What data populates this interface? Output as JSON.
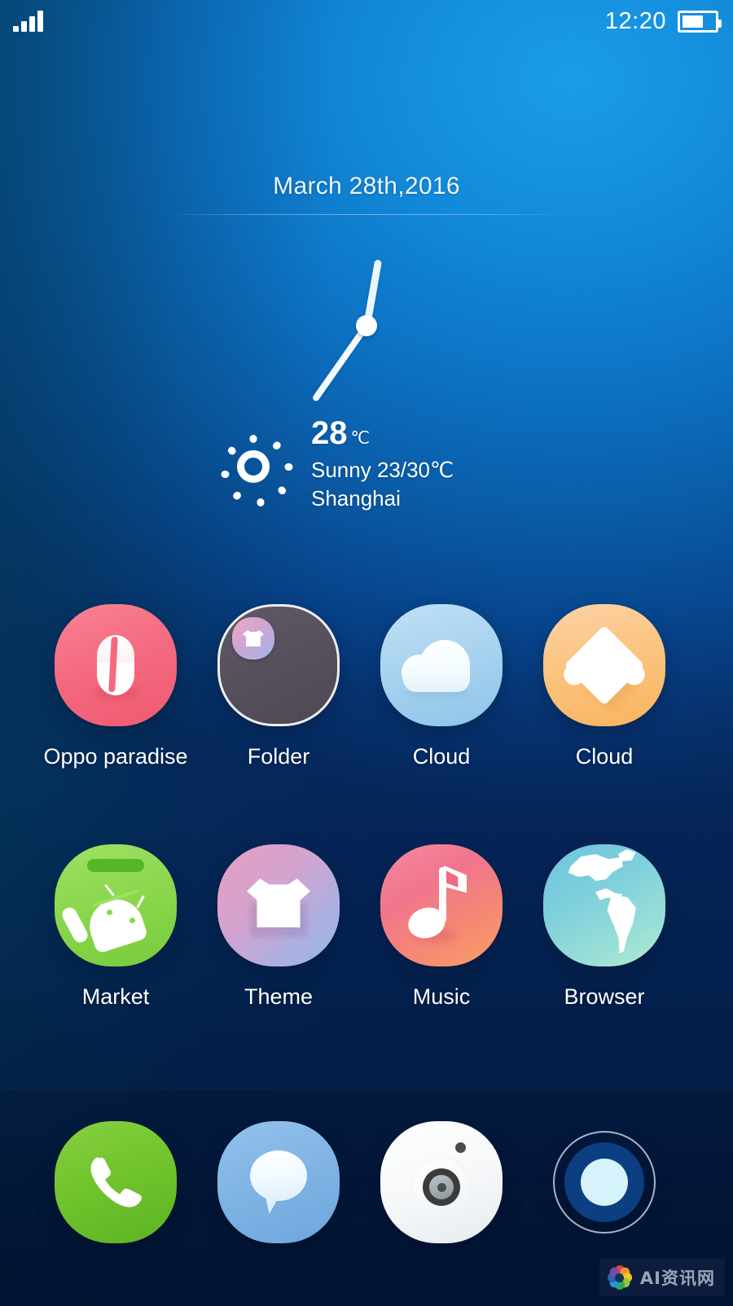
{
  "status_bar": {
    "signal_icon": "signal-bars-icon",
    "signal_bars": 4,
    "time": "12:20",
    "battery_icon": "battery-icon",
    "battery_percent": 65
  },
  "widgets": {
    "date": "March 28th,2016",
    "clock": {
      "name": "analog-clock-widget",
      "hour_hand_deg": 10,
      "minute_hand_deg": 215
    },
    "weather": {
      "icon": "sun-icon",
      "temperature": "28",
      "unit": "℃",
      "condition_line": "Sunny 23/30℃",
      "city": "Shanghai"
    }
  },
  "app_grid": {
    "rows": [
      [
        {
          "label": "Oppo paradise",
          "icon": "oppo-paradise-icon"
        },
        {
          "label": "Folder",
          "icon": "folder-icon"
        },
        {
          "label": "Cloud",
          "icon": "cloud-icon"
        },
        {
          "label": "Cloud",
          "icon": "puzzle-icon"
        }
      ],
      [
        {
          "label": "Market",
          "icon": "market-icon"
        },
        {
          "label": "Theme",
          "icon": "theme-icon"
        },
        {
          "label": "Music",
          "icon": "music-icon"
        },
        {
          "label": "Browser",
          "icon": "browser-icon"
        }
      ]
    ]
  },
  "dock": {
    "items": [
      {
        "icon": "phone-icon"
      },
      {
        "icon": "message-icon"
      },
      {
        "icon": "camera-icon"
      },
      {
        "icon": "app-drawer-icon"
      }
    ]
  },
  "watermark": {
    "text": "AI资讯网",
    "logo": "flower-logo-icon"
  },
  "colors": {
    "wallpaper_light": "#1b9ce8",
    "wallpaper_dark": "#05265a",
    "oppo_pink": "#f4697f",
    "cloud_blue": "#a6d2ef",
    "puzzle_orange": "#fbc480",
    "market_green": "#8bd74e",
    "theme_purple": "#d4a3cf",
    "music_coral": "#f1758c",
    "browser_teal": "#7fd0dc",
    "phone_green": "#6fc32c",
    "message_blue": "#7eb3e4",
    "drawer_blue": "#0c3f81"
  }
}
